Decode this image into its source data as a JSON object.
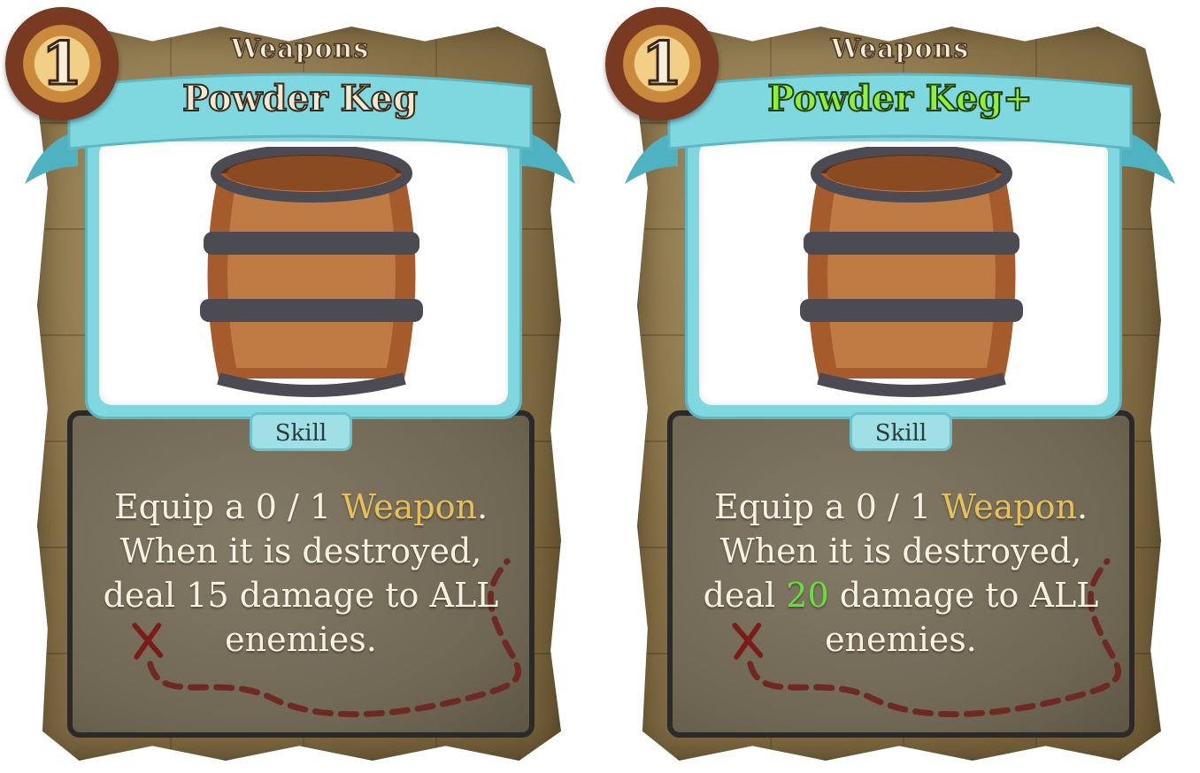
{
  "cards": [
    {
      "cost": "1",
      "type": "Weapons",
      "name": "Powder Keg",
      "kind": "Skill",
      "text": {
        "line1_pre": "Equip a 0 / 1 ",
        "line1_kw": "Weapon",
        "line1_post": ".",
        "line2": "When it is destroyed,",
        "line3_pre": "deal ",
        "line3_num": "15",
        "line3_post": " damage to ALL",
        "line4": "enemies."
      }
    },
    {
      "cost": "1",
      "type": "Weapons",
      "name": "Powder Keg+",
      "kind": "Skill",
      "text": {
        "line1_pre": "Equip a 0 / 1 ",
        "line1_kw": "Weapon",
        "line1_post": ".",
        "line2": "When it is destroyed,",
        "line3_pre": "deal ",
        "line3_num": "20",
        "line3_post": " damage to ALL",
        "line4": "enemies."
      }
    }
  ],
  "colors": {
    "keyword": "#e7c05a",
    "upgraded": "#66e13a",
    "ribbon": "#7fd7df"
  },
  "icons": {
    "cost_badge": "cost-orb-icon",
    "art": "barrel-icon",
    "map": "treasure-map-icon"
  }
}
